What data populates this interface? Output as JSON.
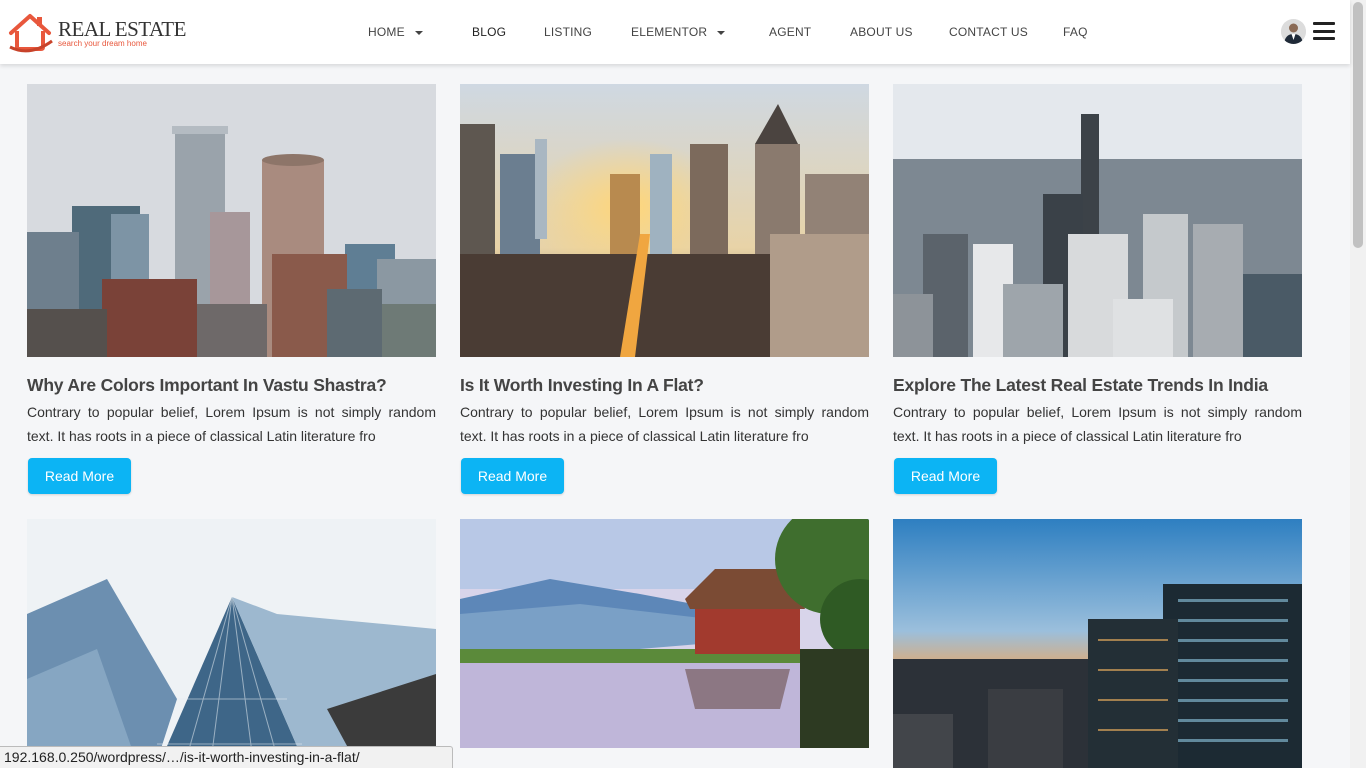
{
  "brand": {
    "name": "REAL ESTATE",
    "tagline": "search your dream home",
    "accent": "#e8573c"
  },
  "nav": {
    "items": [
      {
        "label": "HOME",
        "dropdown": true
      },
      {
        "label": "BLOG",
        "dropdown": false,
        "active": true
      },
      {
        "label": "LISTING",
        "dropdown": false
      },
      {
        "label": "ELEMENTOR",
        "dropdown": true
      },
      {
        "label": "AGENT",
        "dropdown": false
      },
      {
        "label": "ABOUT US",
        "dropdown": false
      },
      {
        "label": "CONTACT US",
        "dropdown": false
      },
      {
        "label": "FAQ",
        "dropdown": false
      }
    ],
    "avatar_icon": "user-avatar",
    "menu_icon": "hamburger-menu-icon"
  },
  "posts": [
    {
      "title": "Why Are Colors Important In Vastu Shastra?",
      "excerpt": "Contrary to popular belief, Lorem Ipsum is not simply random text. It has roots in a piece of classical Latin literature fro",
      "button": "Read More",
      "image": "city-skyline-overcast"
    },
    {
      "title": "Is It Worth Investing In A Flat?",
      "excerpt": "Contrary to popular belief, Lorem Ipsum is not simply random text. It has roots in a piece of classical Latin literature fro",
      "button": "Read More",
      "image": "city-street-sunset"
    },
    {
      "title": "Explore The Latest Real Estate Trends In India",
      "excerpt": "Contrary to popular belief, Lorem Ipsum is not simply random text. It has roots in a piece of classical Latin literature fro",
      "button": "Read More",
      "image": "aerial-city-view"
    },
    {
      "title": "",
      "excerpt": "",
      "button": "",
      "image": "glass-skyscrapers"
    },
    {
      "title": "",
      "excerpt": "",
      "button": "",
      "image": "mountain-lake-house"
    },
    {
      "title": "",
      "excerpt": "",
      "button": "",
      "image": "city-dusk-towers"
    }
  ],
  "status_url": "192.168.0.250/wordpress/…/is-it-worth-investing-in-a-flat/",
  "colors": {
    "button": "#0cb4f4",
    "background": "#f5f6f8"
  }
}
